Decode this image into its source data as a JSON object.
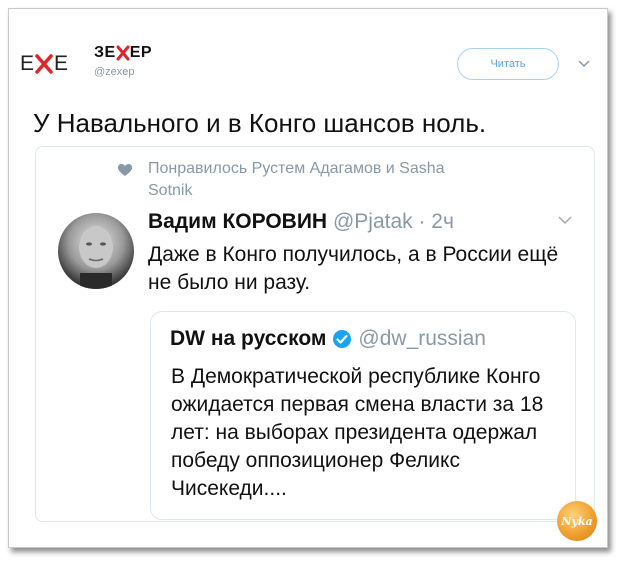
{
  "account": {
    "logo": {
      "left": "E",
      "right": "E"
    },
    "brand": {
      "part1": "ЗЕ",
      "part2": "ЕР"
    },
    "handle": "@zexep"
  },
  "follow_button": {
    "label": "Читать"
  },
  "tweet": {
    "text": "У Навального и в Конго шансов ноль."
  },
  "quoted": {
    "liked_by": "Понравилось Рустем Адагамов и Sasha Sotnik",
    "author_name": "Вадим КОРОВИН",
    "author_meta": "@Pjatak · 2ч",
    "text": "Даже в Конго получилось, а в России ещё не было ни разу."
  },
  "nested_quote": {
    "author_name": "DW на русском",
    "handle": "@dw_russian",
    "text": "В Демократической республике Конго ожидается первая смена власти за 18 лет: на выборах президента одержал победу оппозиционер Феликс Чисекеди...."
  },
  "badge": {
    "label": "Nyka"
  },
  "colors": {
    "accent_red": "#e0242a",
    "link_blue": "#5ba4d9",
    "muted": "#8899a6",
    "verified": "#1da1f2",
    "badge_orange": "#f0a030"
  }
}
